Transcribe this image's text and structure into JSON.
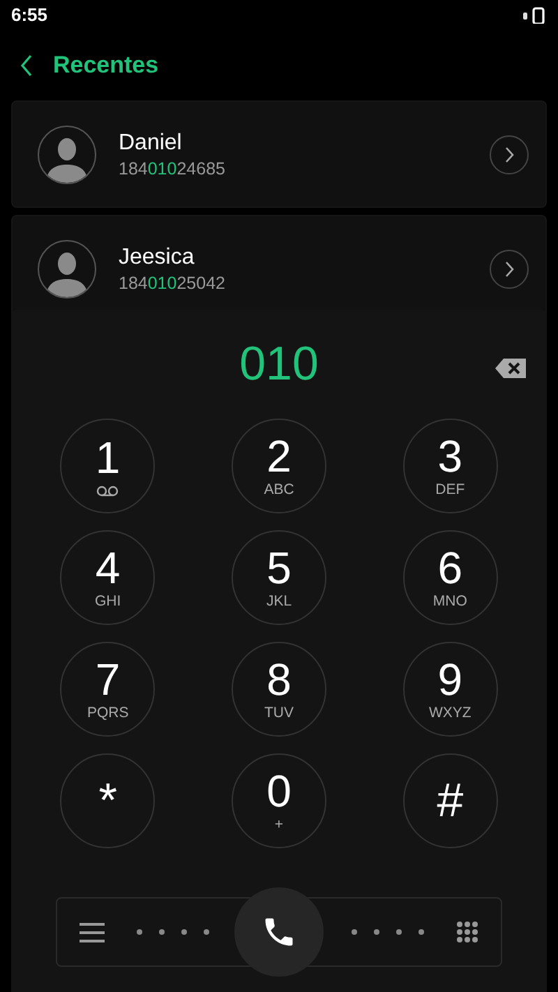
{
  "status_bar": {
    "time": "6:55"
  },
  "header": {
    "title": "Recentes"
  },
  "contacts": [
    {
      "name": "Daniel",
      "number": [
        {
          "text": "184",
          "match": false
        },
        {
          "text": "010",
          "match": true
        },
        {
          "text": "24685",
          "match": false
        }
      ]
    },
    {
      "name": "Jeesica",
      "number": [
        {
          "text": "184",
          "match": false
        },
        {
          "text": "010",
          "match": true
        },
        {
          "text": "25042",
          "match": false
        }
      ]
    }
  ],
  "dialpad": {
    "entry": "010",
    "keys": [
      {
        "digit": "1",
        "kind": "voicemail"
      },
      {
        "digit": "2",
        "letters": "ABC",
        "kind": "letters"
      },
      {
        "digit": "3",
        "letters": "DEF",
        "kind": "letters"
      },
      {
        "digit": "4",
        "letters": "GHI",
        "kind": "letters"
      },
      {
        "digit": "5",
        "letters": "JKL",
        "kind": "letters"
      },
      {
        "digit": "6",
        "letters": "MNO",
        "kind": "letters"
      },
      {
        "digit": "7",
        "letters": "PQRS",
        "kind": "letters"
      },
      {
        "digit": "8",
        "letters": "TUV",
        "kind": "letters"
      },
      {
        "digit": "9",
        "letters": "WXYZ",
        "kind": "letters"
      },
      {
        "digit": "*",
        "kind": "symbol"
      },
      {
        "digit": "0",
        "letters": "+",
        "kind": "letters"
      },
      {
        "digit": "#",
        "kind": "symbol"
      }
    ]
  }
}
